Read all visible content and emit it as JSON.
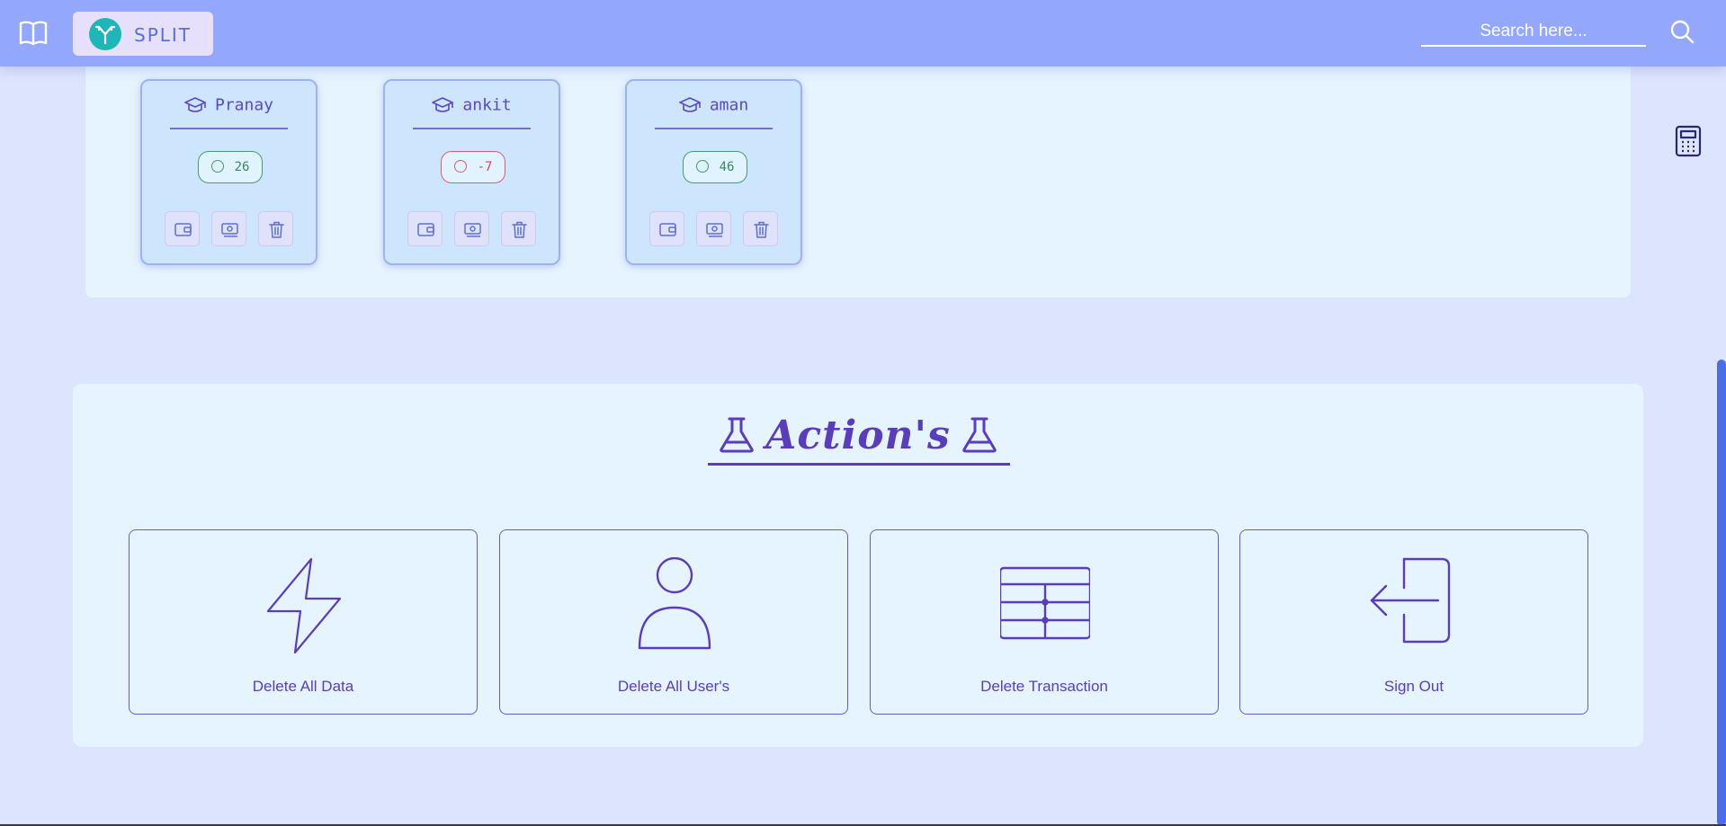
{
  "header": {
    "logo_text": "SPLIT",
    "search_placeholder": "Search here..."
  },
  "users": [
    {
      "name": "Pranay",
      "balance": "26",
      "status": "positive"
    },
    {
      "name": "ankit",
      "balance": "-7",
      "status": "negative"
    },
    {
      "name": "aman",
      "balance": "46",
      "status": "positive"
    }
  ],
  "actions": {
    "title": "Action's",
    "buttons": [
      {
        "label": "Delete All Data",
        "icon": "lightning-icon"
      },
      {
        "label": "Delete All User's",
        "icon": "user-icon"
      },
      {
        "label": "Delete Transaction",
        "icon": "table-icon"
      },
      {
        "label": "Sign Out",
        "icon": "sign-out-icon"
      }
    ]
  },
  "colors": {
    "header_bg": "#93a8fd",
    "page_bg": "#dde4fd",
    "panel_bg": "#e6f4ff",
    "accent": "#5a3dbd",
    "positive": "#3fa06a",
    "negative": "#e05a78",
    "scrollbar": "#4b6ee8"
  }
}
